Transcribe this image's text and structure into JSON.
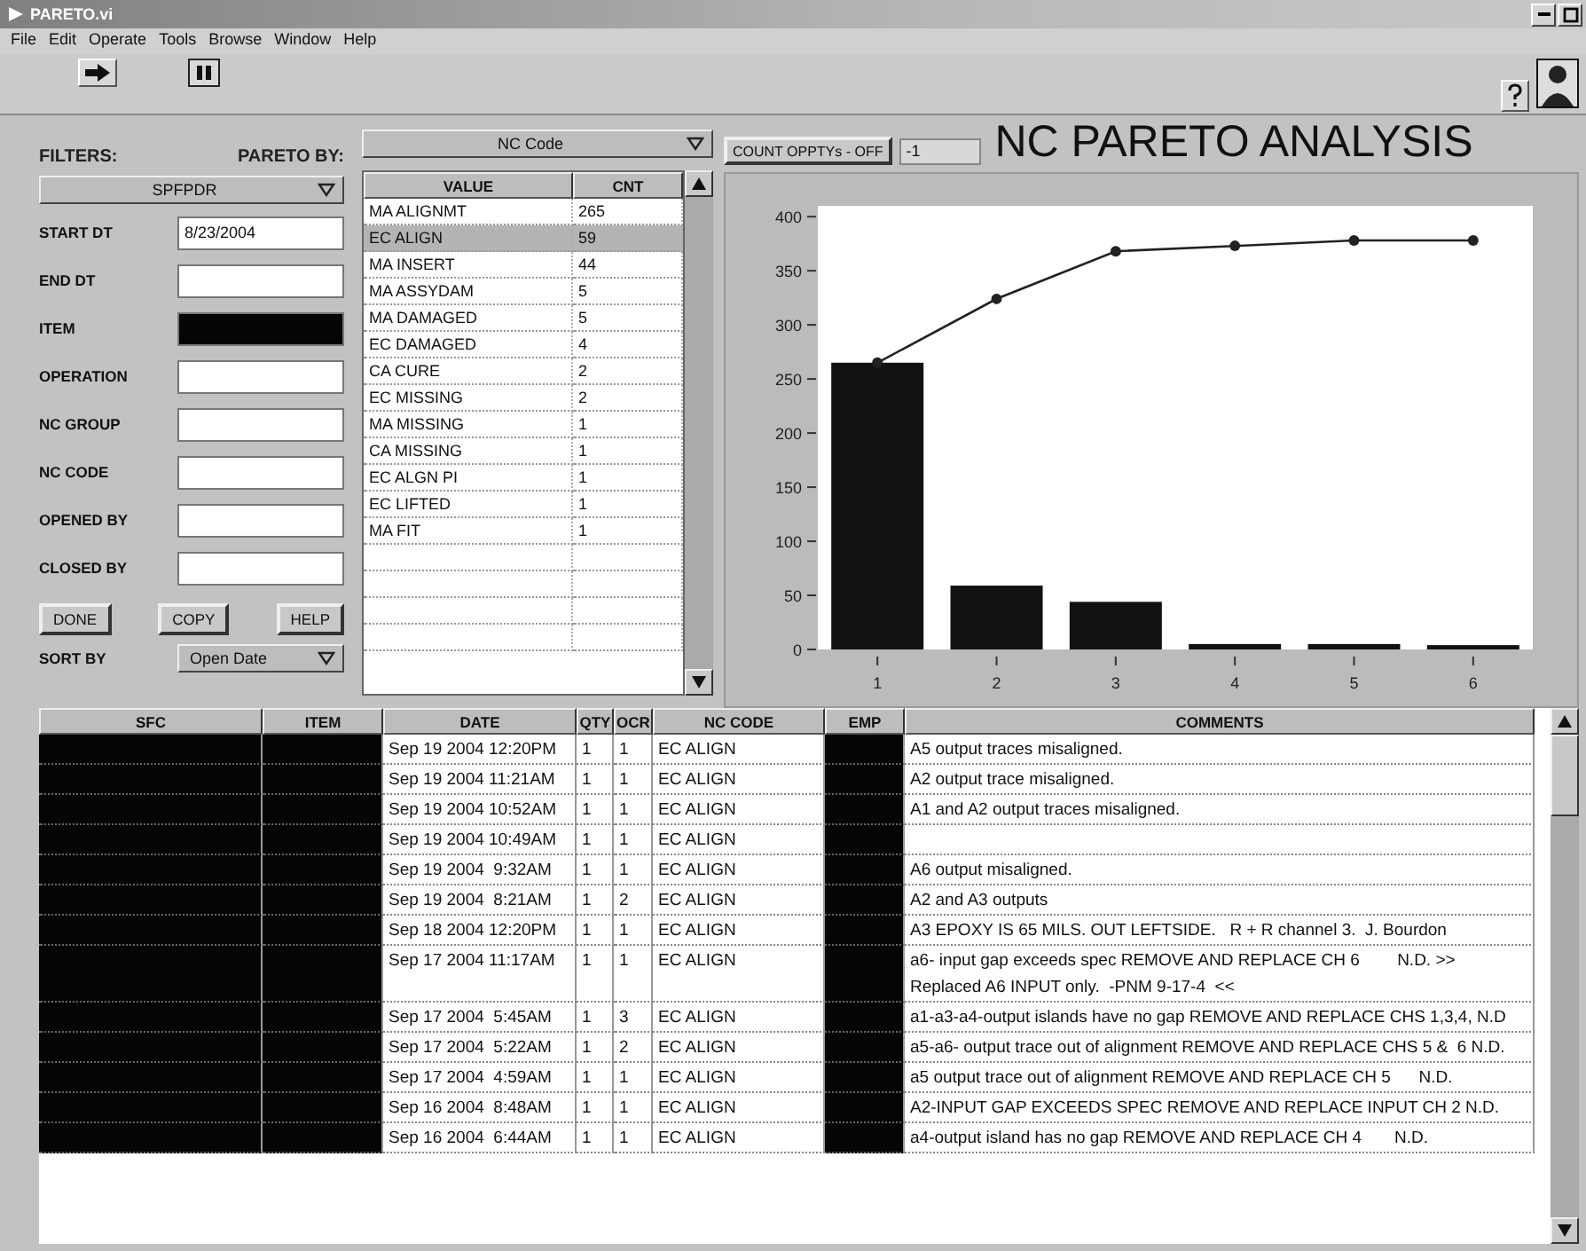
{
  "window": {
    "title": "PARETO.vi"
  },
  "menu": [
    "File",
    "Edit",
    "Operate",
    "Tools",
    "Browse",
    "Window",
    "Help"
  ],
  "filters": {
    "label": "FILTERS:",
    "pareto_by_label": "PARETO BY:",
    "filter_select": "SPFPDR",
    "fields": [
      {
        "label": "START DT",
        "value": "8/23/2004",
        "masked": false
      },
      {
        "label": "END DT",
        "masked": false
      },
      {
        "label": "ITEM",
        "masked": true
      },
      {
        "label": "OPERATION",
        "masked": false
      },
      {
        "label": "NC GROUP",
        "masked": false
      },
      {
        "label": "NC CODE",
        "masked": false
      },
      {
        "label": "OPENED BY",
        "masked": false
      },
      {
        "label": "CLOSED BY",
        "masked": false
      }
    ],
    "buttons": [
      "DONE",
      "COPY",
      "HELP"
    ],
    "sort_by_label": "SORT BY",
    "sort_select": "Open Date"
  },
  "pareto": {
    "select": "NC Code",
    "columns": [
      "VALUE",
      "CNT"
    ],
    "rows": [
      {
        "value": "MA ALIGNMT",
        "count": "265",
        "selected": false
      },
      {
        "value": "EC ALIGN",
        "count": "59",
        "selected": true
      },
      {
        "value": "MA INSERT",
        "count": "44",
        "selected": false
      },
      {
        "value": "MA ASSYDAM",
        "count": "5",
        "selected": false
      },
      {
        "value": "MA DAMAGED",
        "count": "5",
        "selected": false
      },
      {
        "value": "EC DAMAGED",
        "count": "4",
        "selected": false
      },
      {
        "value": "CA CURE",
        "count": "2",
        "selected": false
      },
      {
        "value": "EC MISSING",
        "count": "2",
        "selected": false
      },
      {
        "value": "MA MISSING",
        "count": "1",
        "selected": false
      },
      {
        "value": "CA MISSING",
        "count": "1",
        "selected": false
      },
      {
        "value": "EC ALGN PI",
        "count": "1",
        "selected": false
      },
      {
        "value": "EC LIFTED",
        "count": "1",
        "selected": false
      },
      {
        "value": "MA FIT",
        "count": "1",
        "selected": false
      }
    ]
  },
  "count_button": "COUNT OPPTYs - OFF",
  "count_field": "-1",
  "heading": "NC PARETO ANALYSIS",
  "chart": {
    "chart_data": {
      "type": "bar",
      "stacked": false,
      "categories": [
        "1",
        "2",
        "3",
        "4",
        "5",
        "6"
      ],
      "ylim": [
        0,
        410
      ],
      "yticks": [
        0,
        50,
        100,
        150,
        200,
        250,
        300,
        350,
        400
      ],
      "series": [
        {
          "color": "#111111",
          "values": [
            265,
            59,
            44,
            5,
            5,
            4
          ]
        },
        {
          "type": "line",
          "marker": "circle",
          "color": "#222222",
          "values": [
            265,
            324,
            368,
            373,
            378,
            378
          ]
        }
      ]
    }
  },
  "records": {
    "columns": [
      "SFC",
      "ITEM",
      "DATE",
      "QTY",
      "OCR",
      "NC CODE",
      "EMP",
      "COMMENTS"
    ],
    "rows": [
      {
        "date": "Sep 19 2004 12:20PM",
        "qty": "1",
        "ocr": "1",
        "nc_code": "EC ALIGN",
        "comment": "A5 output traces misaligned."
      },
      {
        "date": "Sep 19 2004 11:21AM",
        "qty": "1",
        "ocr": "1",
        "nc_code": "EC ALIGN",
        "comment": "A2 output trace misaligned."
      },
      {
        "date": "Sep 19 2004 10:52AM",
        "qty": "1",
        "ocr": "1",
        "nc_code": "EC ALIGN",
        "comment": "A1 and A2 output traces misaligned."
      },
      {
        "date": "Sep 19 2004 10:49AM",
        "qty": "1",
        "ocr": "1",
        "nc_code": "EC ALIGN"
      },
      {
        "date": "Sep 19 2004  9:32AM",
        "qty": "1",
        "ocr": "1",
        "nc_code": "EC ALIGN",
        "comment": "A6 output misaligned."
      },
      {
        "date": "Sep 19 2004  8:21AM",
        "qty": "1",
        "ocr": "2",
        "nc_code": "EC ALIGN",
        "comment": "A2 and A3 outputs"
      },
      {
        "date": "Sep 18 2004 12:20PM",
        "qty": "1",
        "ocr": "1",
        "nc_code": "EC ALIGN",
        "comment": "A3 EPOXY IS 65 MILS. OUT LEFTSIDE.   R + R channel 3.  J. Bourdon"
      },
      {
        "date": "Sep 17 2004 11:17AM",
        "qty": "1",
        "ocr": "1",
        "nc_code": "EC ALIGN",
        "comment": "a6- input gap exceeds spec REMOVE AND REPLACE CH 6        N.D. >> Replaced A6 INPUT only.  -PNM 9-17-4  <<"
      },
      {
        "date": "Sep 17 2004  5:45AM",
        "qty": "1",
        "ocr": "3",
        "nc_code": "EC ALIGN",
        "comment": "a1-a3-a4-output islands have no gap REMOVE AND REPLACE CHS 1,3,4, N.D"
      },
      {
        "date": "Sep 17 2004  5:22AM",
        "qty": "1",
        "ocr": "2",
        "nc_code": "EC ALIGN",
        "comment": "a5-a6- output trace out of alignment REMOVE AND REPLACE CHS 5 &  6 N.D."
      },
      {
        "date": "Sep 17 2004  4:59AM",
        "qty": "1",
        "ocr": "1",
        "nc_code": "EC ALIGN",
        "comment": "a5 output trace out of alignment REMOVE AND REPLACE CH 5      N.D."
      },
      {
        "date": "Sep 16 2004  8:48AM",
        "qty": "1",
        "ocr": "1",
        "nc_code": "EC ALIGN",
        "comment": "A2-INPUT GAP EXCEEDS SPEC REMOVE AND REPLACE INPUT CH 2 N.D."
      },
      {
        "date": "Sep 16 2004  6:44AM",
        "qty": "1",
        "ocr": "1",
        "nc_code": "EC ALIGN",
        "comment": "a4-output island has no gap REMOVE AND REPLACE CH 4       N.D."
      }
    ]
  }
}
